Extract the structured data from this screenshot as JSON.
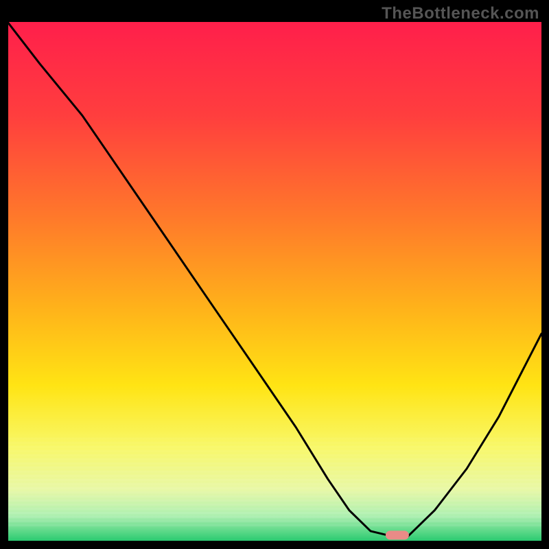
{
  "watermark": "TheBottleneck.com",
  "chart_data": {
    "type": "line",
    "title": "",
    "xlabel": "",
    "ylabel": "",
    "xlim": [
      0,
      100
    ],
    "ylim": [
      0,
      100
    ],
    "series": [
      {
        "name": "curve",
        "x": [
          0,
          6,
          14,
          22,
          30,
          38,
          46,
          54,
          60,
          64,
          68,
          72,
          75,
          80,
          86,
          92,
          100
        ],
        "y": [
          100,
          92,
          82,
          70,
          58,
          46,
          34,
          22,
          12,
          6,
          2,
          1,
          1,
          6,
          14,
          24,
          40
        ]
      }
    ],
    "marker": {
      "x": 73,
      "y": 1.2,
      "color": "#e98b87"
    },
    "gradient_stops": [
      {
        "offset": 0.0,
        "color": "#ff1f4b"
      },
      {
        "offset": 0.18,
        "color": "#ff3e3e"
      },
      {
        "offset": 0.38,
        "color": "#ff7a2a"
      },
      {
        "offset": 0.55,
        "color": "#ffb21a"
      },
      {
        "offset": 0.7,
        "color": "#ffe414"
      },
      {
        "offset": 0.82,
        "color": "#f8f86a"
      },
      {
        "offset": 0.9,
        "color": "#e8f8a6"
      },
      {
        "offset": 0.95,
        "color": "#aef0b0"
      },
      {
        "offset": 1.0,
        "color": "#27c96f"
      }
    ]
  }
}
